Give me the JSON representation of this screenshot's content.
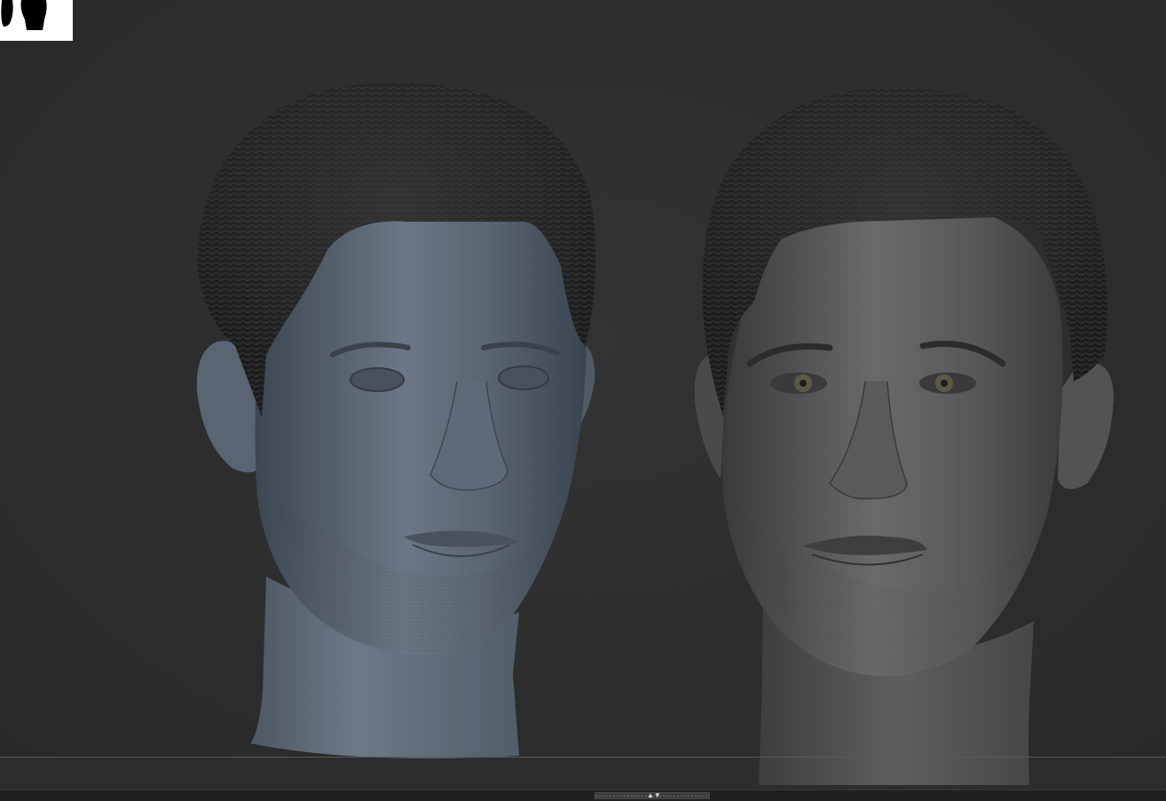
{
  "app": {
    "viewport_background": "#2d2d2d"
  },
  "navigator": {
    "thumbnail_icon": "head-silhouette-thumbnail"
  },
  "models": [
    {
      "name": "",
      "material": "blue-grey-matcap",
      "eyes": "closed-sculpted"
    },
    {
      "name": "",
      "material": "grey-matcap",
      "eyes": "open-with-iris"
    }
  ],
  "bottom_tray": {
    "toggle_icon": "tray-collapse-toggle-icon"
  },
  "colors": {
    "hair": "#262626",
    "left_skin": "#5b6876",
    "right_skin": "#545454",
    "background": "#2d2d2d"
  }
}
